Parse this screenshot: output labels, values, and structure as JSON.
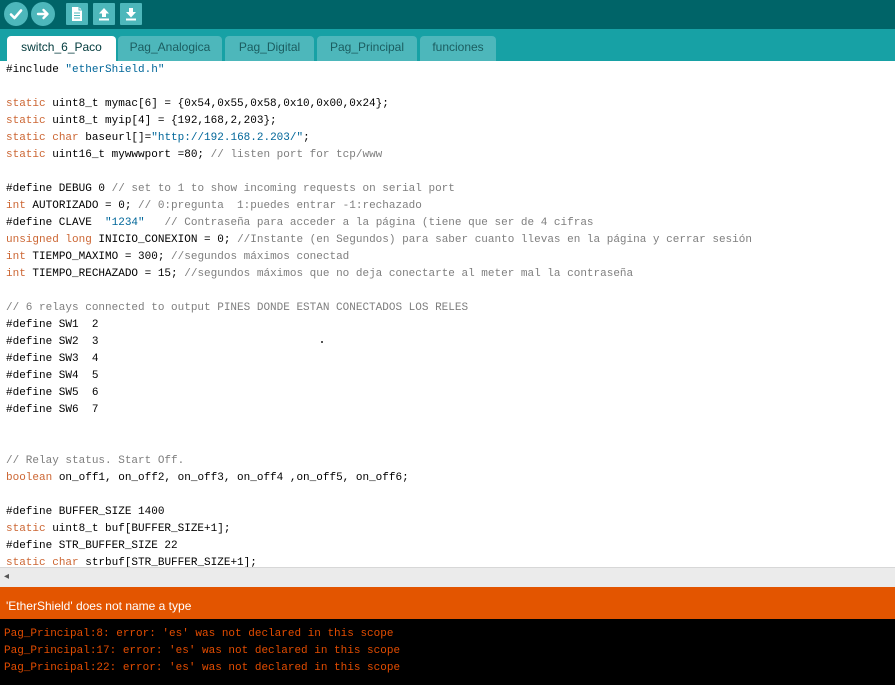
{
  "toolbar": {
    "buttons": [
      {
        "name": "verify-button",
        "icon": "checkmark-icon"
      },
      {
        "name": "upload-button",
        "icon": "arrow-right-icon"
      },
      {
        "name": "new-button",
        "icon": "new-file-icon"
      },
      {
        "name": "open-button",
        "icon": "arrow-up-icon"
      },
      {
        "name": "save-button",
        "icon": "arrow-down-icon"
      }
    ]
  },
  "tabs": [
    {
      "label": "switch_6_Paco",
      "active": true
    },
    {
      "label": "Pag_Analogica",
      "active": false
    },
    {
      "label": "Pag_Digital",
      "active": false
    },
    {
      "label": "Pag_Principal",
      "active": false
    },
    {
      "label": "funciones",
      "active": false
    }
  ],
  "editor": {
    "lines": [
      [
        [
          "p",
          "#include "
        ],
        [
          "s",
          "\"etherShield.h\""
        ]
      ],
      [],
      [
        [
          "k",
          "static"
        ],
        [
          "p",
          " uint8_t mymac[6] = {0x54,0x55,0x58,0x10,0x00,0x24};"
        ]
      ],
      [
        [
          "k",
          "static"
        ],
        [
          "p",
          " uint8_t myip[4] = {192,168,2,203};"
        ]
      ],
      [
        [
          "k",
          "static"
        ],
        [
          "p",
          " "
        ],
        [
          "k",
          "char"
        ],
        [
          "p",
          " baseurl[]="
        ],
        [
          "s",
          "\"http://192.168.2.203/\""
        ],
        [
          "p",
          ";"
        ]
      ],
      [
        [
          "k",
          "static"
        ],
        [
          "p",
          " uint16_t mywwwport =80; "
        ],
        [
          "c",
          "// listen port for tcp/www"
        ]
      ],
      [],
      [
        [
          "p",
          "#define DEBUG 0 "
        ],
        [
          "c",
          "// set to 1 to show incoming requests on serial port"
        ]
      ],
      [
        [
          "k",
          "int"
        ],
        [
          "p",
          " AUTORIZADO = 0; "
        ],
        [
          "c",
          "// 0:pregunta  1:puedes entrar -1:rechazado"
        ]
      ],
      [
        [
          "p",
          "#define CLAVE  "
        ],
        [
          "s",
          "\"1234\""
        ],
        [
          "p",
          "   "
        ],
        [
          "c",
          "// Contraseña para acceder a la página (tiene que ser de 4 cifras"
        ]
      ],
      [
        [
          "k",
          "unsigned"
        ],
        [
          "p",
          " "
        ],
        [
          "k",
          "long"
        ],
        [
          "p",
          " INICIO_CONEXION = 0; "
        ],
        [
          "c",
          "//Instante (en Segundos) para saber cuanto llevas en la página y cerrar sesión"
        ]
      ],
      [
        [
          "k",
          "int"
        ],
        [
          "p",
          " TIEMPO_MAXIMO = 300; "
        ],
        [
          "c",
          "//segundos máximos conectad"
        ]
      ],
      [
        [
          "k",
          "int"
        ],
        [
          "p",
          " TIEMPO_RECHAZADO = 15; "
        ],
        [
          "c",
          "//segundos máximos que no deja conectarte al meter mal la contraseña"
        ]
      ],
      [],
      [
        [
          "c",
          "// 6 relays connected to output PINES DONDE ESTAN CONECTADOS LOS RELES"
        ]
      ],
      [
        [
          "p",
          "#define SW1  2"
        ]
      ],
      [
        [
          "p",
          "#define SW2  3"
        ]
      ],
      [
        [
          "p",
          "#define SW3  4"
        ]
      ],
      [
        [
          "p",
          "#define SW4  5"
        ]
      ],
      [
        [
          "p",
          "#define SW5  6"
        ]
      ],
      [
        [
          "p",
          "#define SW6  7"
        ]
      ],
      [],
      [],
      [
        [
          "c",
          "// Relay status. Start Off."
        ]
      ],
      [
        [
          "k",
          "boolean"
        ],
        [
          "p",
          " on_off1, on_off2, on_off3, on_off4 ,on_off5, on_off6;"
        ]
      ],
      [],
      [
        [
          "p",
          "#define BUFFER_SIZE 1400"
        ]
      ],
      [
        [
          "k",
          "static"
        ],
        [
          "p",
          " uint8_t buf[BUFFER_SIZE+1];"
        ]
      ],
      [
        [
          "p",
          "#define STR_BUFFER_SIZE 22"
        ]
      ],
      [
        [
          "k",
          "static"
        ],
        [
          "p",
          " "
        ],
        [
          "k",
          "char"
        ],
        [
          "p",
          " strbuf[STR_BUFFER_SIZE+1];"
        ]
      ]
    ]
  },
  "status": {
    "message": "'EtherShield' does not name a type"
  },
  "console": {
    "lines": [
      "Pag_Principal:8: error: 'es' was not declared in this scope",
      "Pag_Principal:17: error: 'es' was not declared in this scope",
      "Pag_Principal:22: error: 'es' was not declared in this scope"
    ]
  },
  "colors": {
    "toolbar": "#006468",
    "tabstrip": "#17a1a5",
    "tab_inactive": "#4db7bb",
    "keyword": "#cc6633",
    "string": "#006699",
    "comment": "#7e7e7e",
    "status_bg": "#e35500",
    "console_text": "#e34c00"
  }
}
